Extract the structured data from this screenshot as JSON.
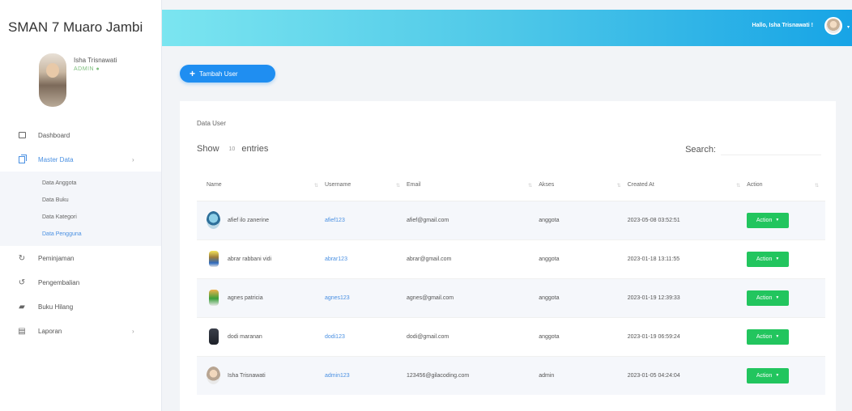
{
  "app": {
    "title": "SMAN 7 Muaro Jambi"
  },
  "profile": {
    "name": "Isha Trisnawati",
    "role": "ADMIN"
  },
  "nav": {
    "dashboard": "Dashboard",
    "master_data": "Master Data",
    "sub": [
      "Data Anggota",
      "Data Buku",
      "Data Kategori",
      "Data Pengguna"
    ],
    "peminjaman": "Peminjaman",
    "pengembalian": "Pengembalian",
    "buku_hilang": "Buku Hilang",
    "laporan": "Laporan"
  },
  "header": {
    "greeting": "Hallo, Isha Trisnawati !"
  },
  "toolbar": {
    "add_label": "Tambah User"
  },
  "card": {
    "title": "Data User",
    "show_label": "Show",
    "entries_value": "10",
    "entries_label": "entries",
    "search_label": "Search:"
  },
  "table": {
    "columns": [
      "Name",
      "Username",
      "Email",
      "Akses",
      "Created At",
      "Action"
    ],
    "rows": [
      {
        "name": "afief ilo zanerine",
        "username": "afief123",
        "email": "afief@gmail.com",
        "akses": "anggota",
        "created": "2023-05-08 03:52:51",
        "action": "Action"
      },
      {
        "name": "abrar rabbani vidi",
        "username": "abrar123",
        "email": "abrar@gmail.com",
        "akses": "anggota",
        "created": "2023-01-18 13:11:55",
        "action": "Action"
      },
      {
        "name": "agnes patricia",
        "username": "agnes123",
        "email": "agnes@gmail.com",
        "akses": "anggota",
        "created": "2023-01-19 12:39:33",
        "action": "Action"
      },
      {
        "name": "dodi maranan",
        "username": "dodi123",
        "email": "dodi@gmail.com",
        "akses": "anggota",
        "created": "2023-01-19 06:59:24",
        "action": "Action"
      },
      {
        "name": "Isha Trisnawati",
        "username": "admin123",
        "email": "123456@gilacoding.com",
        "akses": "admin",
        "created": "2023-01-05 04:24:04",
        "action": "Action"
      }
    ]
  }
}
